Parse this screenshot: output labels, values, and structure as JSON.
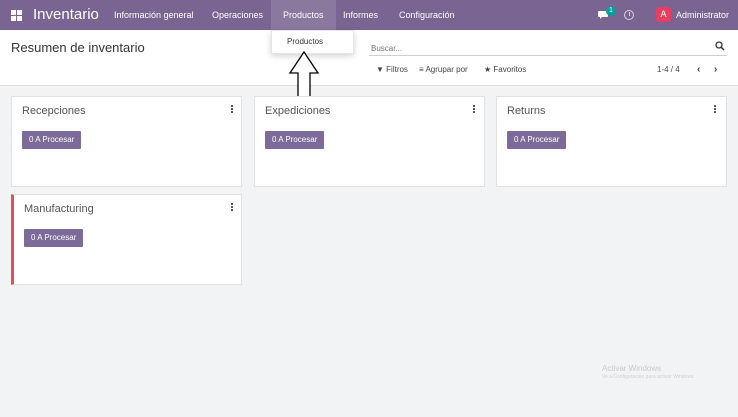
{
  "navbar": {
    "brand": "Inventario",
    "menu": [
      "Información general",
      "Operaciones",
      "Productos",
      "Informes",
      "Configuración"
    ],
    "chat_count": "1",
    "avatar_letter": "A",
    "username": "Administrator"
  },
  "control": {
    "title": "Resumen de inventario",
    "search_placeholder": "Buscar...",
    "filters": "Filtros",
    "group_by": "Agrupar por",
    "favorites": "Favoritos",
    "pager": "1-4 / 4"
  },
  "dropdown": {
    "items": [
      "Productos"
    ]
  },
  "cards": [
    {
      "title": "Recepciones",
      "button": "0 A Procesar"
    },
    {
      "title": "Expediciones",
      "button": "0 A Procesar"
    },
    {
      "title": "Returns",
      "button": "0 A Procesar"
    },
    {
      "title": "Manufacturing",
      "button": "0 A Procesar"
    }
  ],
  "watermark": {
    "line1": "Activar Windows",
    "line2": "Ve a Configuración para activar Windows."
  },
  "colors": {
    "navbar": "#7a6491",
    "button": "#7c6a98",
    "accent_red": "#e0525a",
    "badge": "#00a09d",
    "avatar": "#e4405f"
  },
  "icons": [
    "apps-grid-icon",
    "chat-icon",
    "clock-icon",
    "search-icon",
    "filter-icon",
    "group-by-icon",
    "star-icon",
    "chevron-left-icon",
    "chevron-right-icon",
    "kebab-menu-icon",
    "up-arrow-annotation-icon"
  ]
}
